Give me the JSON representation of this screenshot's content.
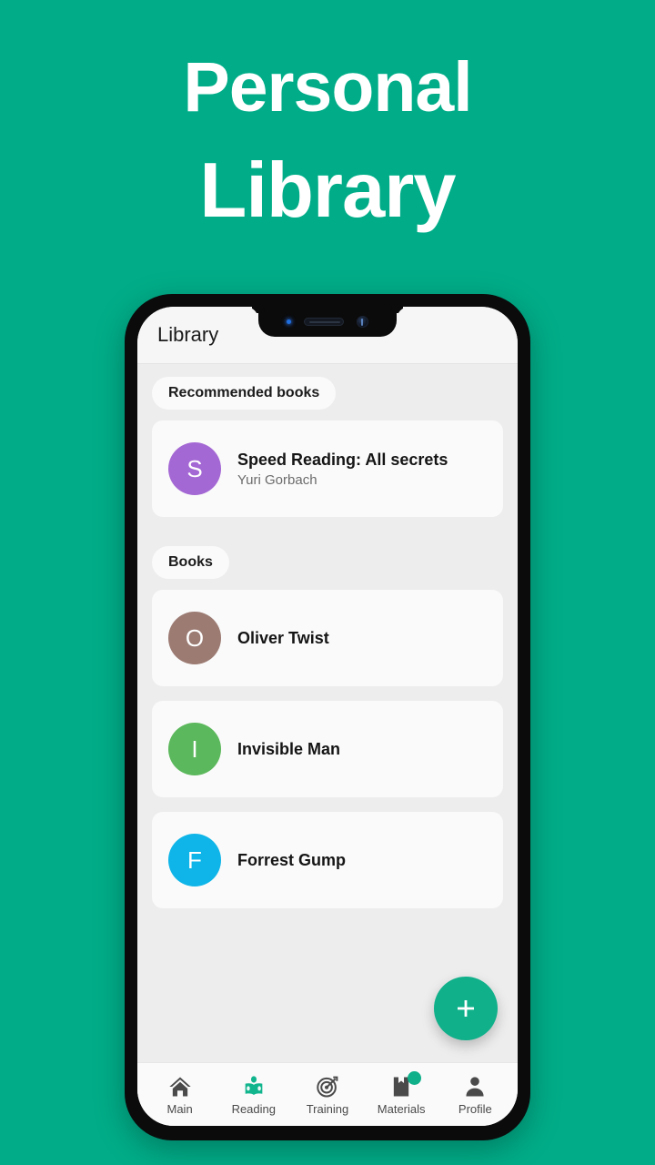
{
  "hero": {
    "line1": "Personal",
    "line2": "Library"
  },
  "theme": {
    "background": "#00AD88",
    "accent": "#0fb08a",
    "screen_bg": "#ededed",
    "card_bg": "#fafafa",
    "appbar_bg": "#f6f6f6"
  },
  "app": {
    "appbar": {
      "title": "Library"
    },
    "sections": [
      {
        "chip_label": "Recommended books",
        "items": [
          {
            "initial": "S",
            "avatar_color": "#A468D4",
            "title": "Speed Reading: All secrets",
            "author": "Yuri Gorbach"
          }
        ]
      },
      {
        "chip_label": "Books",
        "items": [
          {
            "initial": "O",
            "avatar_color": "#9C7B73",
            "title": "Oliver Twist",
            "author": ""
          },
          {
            "initial": "I",
            "avatar_color": "#5CB85C",
            "title": "Invisible Man",
            "author": ""
          },
          {
            "initial": "F",
            "avatar_color": "#0FB5E8",
            "title": "Forrest Gump",
            "author": ""
          }
        ]
      }
    ],
    "fab": {
      "icon": "plus-icon",
      "label": "+"
    },
    "bottom_nav": {
      "items": [
        {
          "label": "Main",
          "icon": "home-icon",
          "active": false,
          "badge": false
        },
        {
          "label": "Reading",
          "icon": "reading-icon",
          "active": true,
          "badge": false
        },
        {
          "label": "Training",
          "icon": "target-icon",
          "active": false,
          "badge": false
        },
        {
          "label": "Materials",
          "icon": "bookmark-icon",
          "active": false,
          "badge": true
        },
        {
          "label": "Profile",
          "icon": "person-icon",
          "active": false,
          "badge": false
        }
      ]
    }
  },
  "device": {
    "notch": {
      "led": "status-led",
      "speaker": "earpiece-speaker",
      "camera": "front-camera"
    }
  }
}
